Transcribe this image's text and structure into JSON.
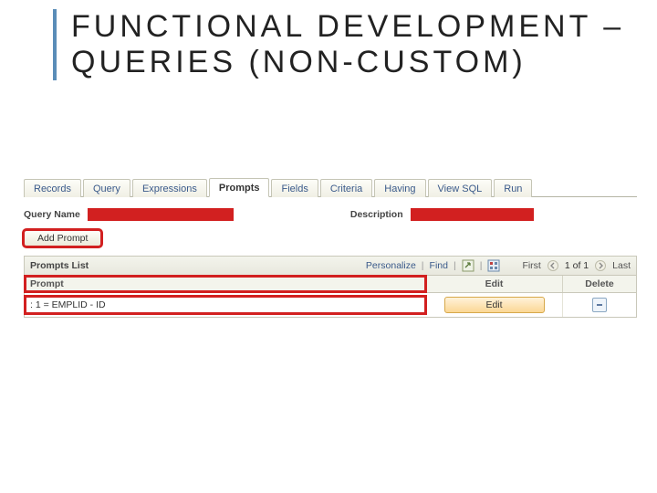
{
  "title": "FUNCTIONAL DEVELOPMENT – QUERIES (NON-CUSTOM)",
  "tabs": [
    {
      "label": "Records",
      "selected": false
    },
    {
      "label": "Query",
      "selected": false
    },
    {
      "label": "Expressions",
      "selected": false
    },
    {
      "label": "Prompts",
      "selected": true
    },
    {
      "label": "Fields",
      "selected": false
    },
    {
      "label": "Criteria",
      "selected": false
    },
    {
      "label": "Having",
      "selected": false
    },
    {
      "label": "View SQL",
      "selected": false
    },
    {
      "label": "Run",
      "selected": false
    }
  ],
  "labels": {
    "query_name": "Query Name",
    "description": "Description",
    "add_prompt": "Add Prompt",
    "prompts_list": "Prompts List"
  },
  "list_controls": {
    "personalize": "Personalize",
    "find": "Find",
    "first": "First",
    "counter": "1 of 1",
    "last": "Last"
  },
  "columns": {
    "prompt": "Prompt",
    "edit": "Edit",
    "delete": "Delete"
  },
  "rows": [
    {
      "prompt": ": 1 = EMPLID - ID",
      "edit_label": "Edit"
    }
  ]
}
